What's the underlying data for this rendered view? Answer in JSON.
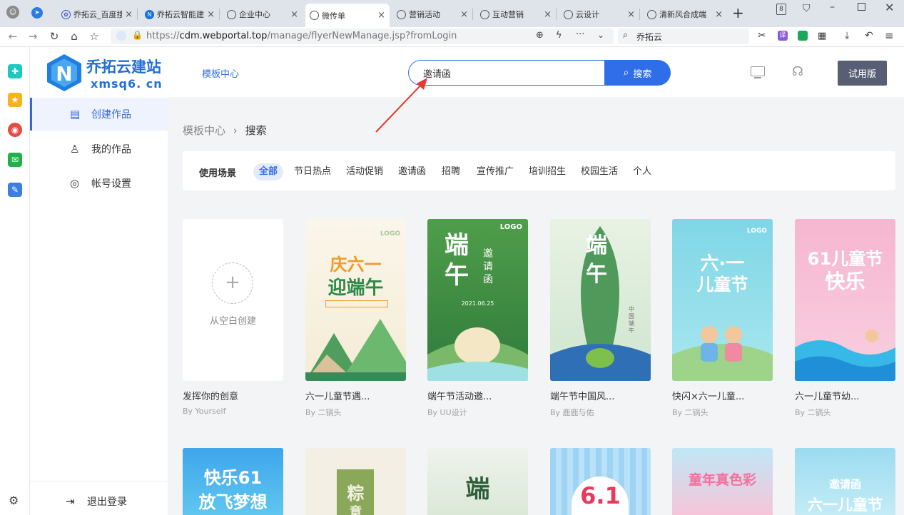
{
  "browser": {
    "tabs": [
      {
        "label": "乔拓云_百度搜",
        "active": false
      },
      {
        "label": "乔拓云智能建站",
        "active": false
      },
      {
        "label": "企业中心",
        "active": false
      },
      {
        "label": "微传单",
        "active": true
      },
      {
        "label": "营销活动",
        "active": false
      },
      {
        "label": "互动营销",
        "active": false
      },
      {
        "label": "云设计",
        "active": false
      },
      {
        "label": "清新风合成端",
        "active": false
      }
    ],
    "tab_close": "×",
    "new_tab": "+",
    "tab_count": "8",
    "url_scheme": "https://",
    "url_host": "cdm.webportal.top",
    "url_path": "/manage/flyerNewManage.jsp?fromLogin",
    "search_engine_text": "乔拓云"
  },
  "app": {
    "logo_cn": "乔拓云建站",
    "logo_en": "xmsq6. cn",
    "header_link": "模板中心",
    "search_value": "邀请函",
    "search_button": "搜索",
    "trial_button": "试用版"
  },
  "sidebar": {
    "items": [
      {
        "label": "创建作品",
        "active": true
      },
      {
        "label": "我的作品",
        "active": false
      },
      {
        "label": "帐号设置",
        "active": false
      }
    ],
    "logout": "退出登录"
  },
  "breadcrumb": {
    "parent": "模板中心",
    "sep": "›",
    "current": "搜索"
  },
  "filter": {
    "label": "使用场景",
    "chips": [
      "全部",
      "节日热点",
      "活动促销",
      "邀请函",
      "招聘",
      "宣传推广",
      "培训招生",
      "校园生活",
      "个人"
    ],
    "active_index": 0
  },
  "blank_card": {
    "plus": "+",
    "label": "从空白创建",
    "title": "发挥你的创意",
    "author": "By Yourself"
  },
  "cards": [
    {
      "title": "六一儿童节遇...",
      "author": "By 二锅头",
      "poster_line1": "庆六一",
      "poster_line2": "迎端午",
      "logo": "LOGO"
    },
    {
      "title": "端午节活动邀...",
      "author": "By UU设计",
      "poster_line1": "端午",
      "poster_line2": "邀请函",
      "logo": "LOGO",
      "date": "2021.06.25"
    },
    {
      "title": "端午节中国风...",
      "author": "By 鹿鹿与佑",
      "poster_line1": "端午",
      "poster_line2": "中国端午"
    },
    {
      "title": "快闪×六一儿童...",
      "author": "By 二锅头",
      "poster_line1": "六·一",
      "poster_line2": "儿童节",
      "logo": "LOGO"
    },
    {
      "title": "六一儿童节幼...",
      "author": "By 二锅头",
      "poster_line1": "61儿童节",
      "poster_line2": "快乐"
    }
  ],
  "row2": [
    {
      "poster_line1": "快乐61",
      "poster_line2": "放飞梦想"
    },
    {
      "poster_line1": "粽",
      "poster_line2": "意"
    },
    {
      "poster_line1": "端",
      "poster_line2": ""
    },
    {
      "poster_line1": "6.1",
      "poster_line2": ""
    },
    {
      "poster_line1": "童年真色彩",
      "poster_line2": ""
    },
    {
      "poster_line1": "邀请函",
      "poster_line2": "六一儿童节"
    }
  ],
  "colors": {
    "accent": "#2f6ee8",
    "trial": "#585e73",
    "arrow": "#e8392c"
  }
}
